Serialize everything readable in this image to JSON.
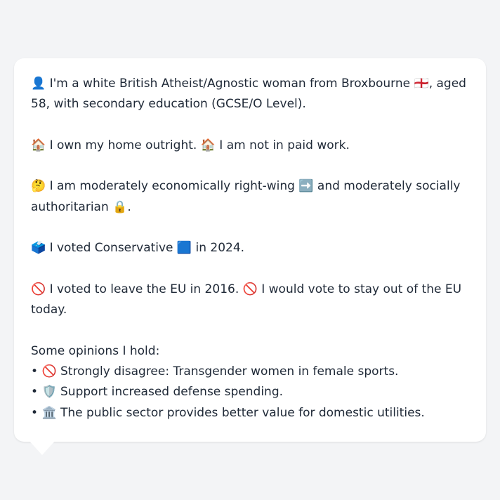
{
  "profile": {
    "identity": {
      "icon": "👤",
      "text_before_flag": "I'm a white British Atheist/Agnostic woman from Broxbourne",
      "flag": "🏴󠁧󠁢󠁥󠁮󠁧󠁿",
      "text_after_flag": ", aged 58, with secondary education (GCSE/O Level)."
    },
    "housing": {
      "icon_1": "🏠",
      "text_1": "I own my home outright.",
      "icon_2": "🏠",
      "text_2": "I am not in paid work."
    },
    "politics": {
      "icon_1": "🤔",
      "text_1": "I am moderately economically right-wing",
      "icon_2": "➡️",
      "text_2": "and moderately socially authoritarian",
      "icon_3": "🔒",
      "text_3": "."
    },
    "vote": {
      "icon_1": "🗳️",
      "text_1": "I voted Conservative",
      "icon_2": "🟦",
      "text_2": "in 2024."
    },
    "eu": {
      "icon_1": "🚫",
      "text_1": "I voted to leave the EU in 2016.",
      "icon_2": "🚫",
      "text_2": "I would vote to stay out of the EU today."
    },
    "opinions": {
      "heading": "Some opinions I hold:",
      "items": [
        {
          "bullet": "•",
          "icon": "🚫",
          "text": "Strongly disagree: Transgender women in female sports."
        },
        {
          "bullet": "•",
          "icon": "🛡️",
          "text": "Support increased defense spending."
        },
        {
          "bullet": "•",
          "icon": "🏛️",
          "text": "The public sector provides better value for domestic utilities."
        }
      ]
    }
  }
}
